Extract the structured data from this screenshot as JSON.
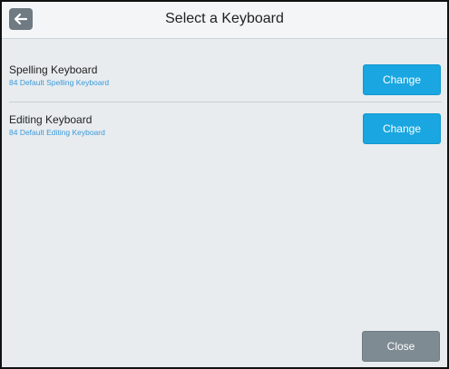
{
  "header": {
    "title": "Select a Keyboard",
    "back_icon": "arrow-left-icon"
  },
  "keyboards": [
    {
      "title": "Spelling Keyboard",
      "subtitle": "84 Default Spelling Keyboard",
      "button_label": "Change"
    },
    {
      "title": "Editing Keyboard",
      "subtitle": "84 Default Editing Keyboard",
      "button_label": "Change"
    }
  ],
  "footer": {
    "close_label": "Close"
  },
  "colors": {
    "accent": "#1aa6e0",
    "subtitle": "#3d9bd9",
    "close_button": "#7f8b93",
    "background": "#e8ecef"
  }
}
